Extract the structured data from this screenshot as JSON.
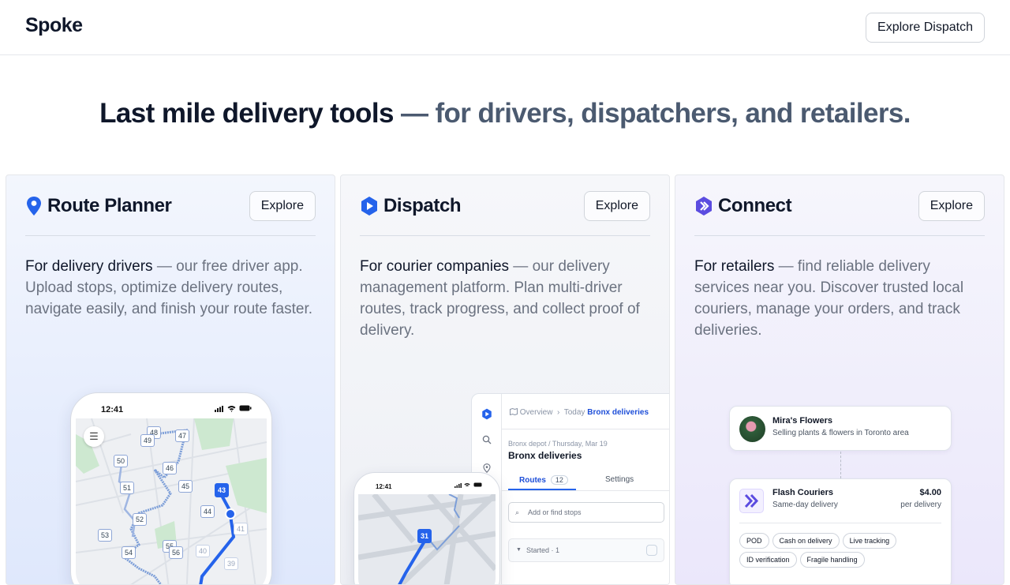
{
  "header": {
    "logo": "Spoke",
    "cta": "Explore Dispatch"
  },
  "hero": {
    "title_dark": "Last mile delivery tools",
    "title_muted": " — for drivers, dispatchers, and retailers."
  },
  "colors": {
    "accent_blue": "#2563eb",
    "accent_purple": "#5b4ce0",
    "text_dark": "#0f172a",
    "text_muted": "#6b7280"
  },
  "cards": [
    {
      "title": "Route Planner",
      "button": "Explore",
      "icon": "location-pin-icon",
      "lead": "For delivery drivers",
      "body": " — our free driver app. Upload stops, optimize delivery routes, navigate easily, and finish your route faster."
    },
    {
      "title": "Dispatch",
      "button": "Explore",
      "icon": "dispatch-logo-icon",
      "lead": "For courier companies",
      "body": " — our delivery management platform. Plan multi-driver routes, track progress, and collect proof of delivery."
    },
    {
      "title": "Connect",
      "button": "Explore",
      "icon": "connect-logo-icon",
      "lead": "For retailers",
      "body": " — find reliable delivery services near you. Discover trusted local couriers, manage your orders, and track deliveries."
    }
  ],
  "route_phone": {
    "time": "12:41",
    "stops": [
      "48",
      "47",
      "49",
      "50",
      "46",
      "51",
      "45",
      "43",
      "44",
      "52",
      "53",
      "54",
      "55",
      "56",
      "40",
      "41",
      "39"
    ],
    "active_stop": "43"
  },
  "dispatch_app": {
    "crumb_1": "Overview",
    "crumb_2": "Today",
    "crumb_3": "Bronx deliveries",
    "subtitle": "Bronx depot / Thursday, Mar 19",
    "title": "Bronx deliveries",
    "tab_routes": "Routes",
    "tab_routes_count": "12",
    "tab_settings": "Settings",
    "search_placeholder": "Add or find stops",
    "group_label": "Started · 1",
    "phone_time": "12:41",
    "phone_stop": "31"
  },
  "connect_app": {
    "shop_name": "Mira's Flowers",
    "shop_desc": "Selling plants & flowers in Toronto area",
    "courier_name": "Flash Couriers",
    "courier_desc": "Same-day delivery",
    "price": "$4.00",
    "price_unit": "per delivery",
    "features": [
      "POD",
      "Cash on delivery",
      "Live tracking",
      "ID verification",
      "Fragile handling"
    ]
  }
}
